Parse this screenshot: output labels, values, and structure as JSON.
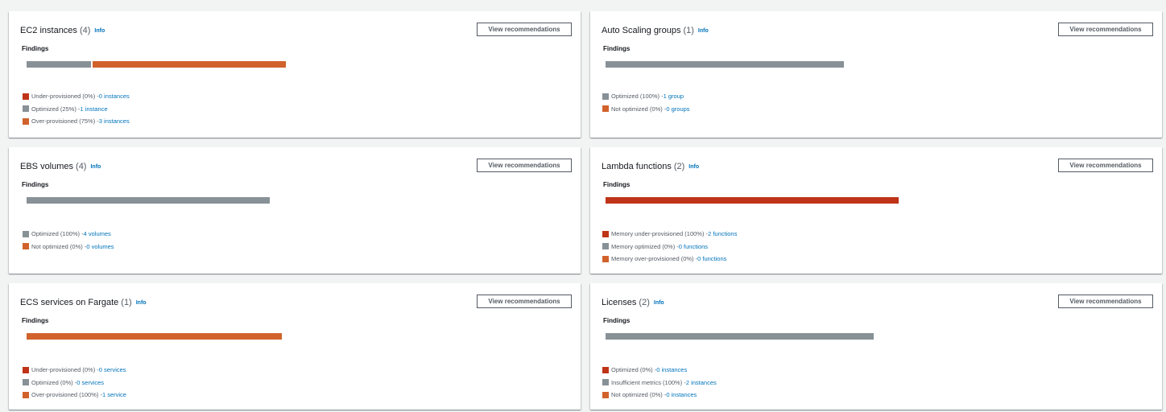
{
  "colors": {
    "under": "#bf3418",
    "optimized": "#879196",
    "over": "#d1622b",
    "link": "#0073bb"
  },
  "view_label": "View recommendations",
  "findings_label": "Findings",
  "info_label": "Info",
  "cards": [
    {
      "title": "EC2 instances",
      "count": "(4)",
      "bar": [
        {
          "color": "optimized",
          "fraction": 0.25
        },
        {
          "color": "over",
          "fraction": 0.75
        }
      ],
      "legend": [
        {
          "color": "under",
          "label": "Under-provisioned (0%) - ",
          "link": "0 instances"
        },
        {
          "color": "optimized",
          "label": "Optimized (25%) - ",
          "link": "1 instance"
        },
        {
          "color": "over",
          "label": "Over-provisioned (75%) - ",
          "link": "3 instances"
        }
      ]
    },
    {
      "title": "Auto Scaling groups",
      "count": "(1)",
      "bar": [
        {
          "color": "optimized",
          "fraction": 1.0
        }
      ],
      "legend": [
        {
          "color": "optimized",
          "label": "Optimized (100%) - ",
          "link": "1 group"
        },
        {
          "color": "over",
          "label": "Not optimized (0%) - ",
          "link": "0 groups"
        }
      ]
    },
    {
      "title": "EBS volumes",
      "count": "(4)",
      "bar": [
        {
          "color": "optimized",
          "fraction": 1.0
        }
      ],
      "legend": [
        {
          "color": "optimized",
          "label": "Optimized (100%) - ",
          "link": "4 volumes"
        },
        {
          "color": "over",
          "label": "Not optimized (0%) - ",
          "link": "0 volumes"
        }
      ]
    },
    {
      "title": "Lambda functions",
      "count": "(2)",
      "bar": [
        {
          "color": "under",
          "fraction": 1.0
        }
      ],
      "legend": [
        {
          "color": "under",
          "label": "Memory under-provisioned (100%) - ",
          "link": "2 functions"
        },
        {
          "color": "optimized",
          "label": "Memory optimized (0%) - ",
          "link": "0 functions"
        },
        {
          "color": "over",
          "label": "Memory over-provisioned (0%) - ",
          "link": "0 functions"
        }
      ]
    },
    {
      "title": "ECS services on Fargate",
      "count": "(1)",
      "bar": [
        {
          "color": "over",
          "fraction": 1.0
        }
      ],
      "legend": [
        {
          "color": "under",
          "label": "Under-provisioned (0%) - ",
          "link": "0 services"
        },
        {
          "color": "optimized",
          "label": "Optimized (0%) - ",
          "link": "0 services"
        },
        {
          "color": "over",
          "label": "Over-provisioned (100%) - ",
          "link": "1 service"
        }
      ]
    },
    {
      "title": "Licenses",
      "count": "(2)",
      "bar": [
        {
          "color": "optimized",
          "fraction": 1.0
        }
      ],
      "legend": [
        {
          "color": "under",
          "label": "Optimized (0%) - ",
          "link": "0 instances"
        },
        {
          "color": "optimized",
          "label": "Insufficient metrics (100%) - ",
          "link": "2 instances"
        },
        {
          "color": "over",
          "label": "Not optimized (0%) - ",
          "link": "0 instances"
        }
      ]
    }
  ]
}
